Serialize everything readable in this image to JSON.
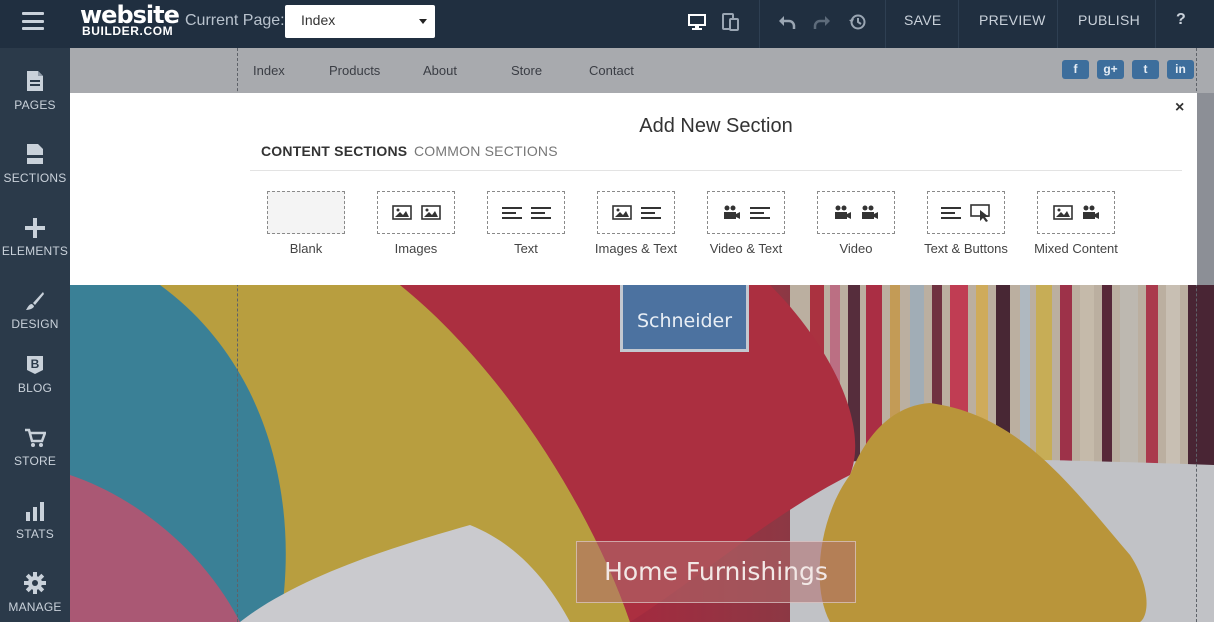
{
  "app": {
    "logo_main": "website",
    "logo_sub": "BUILDER.COM",
    "current_page_label": "Current Page:",
    "current_page_value": "Index"
  },
  "toolbar": {
    "icons": [
      "desktop-icon",
      "mobile-icon",
      "undo-icon",
      "redo-icon",
      "history-icon"
    ],
    "save_label": "SAVE",
    "preview_label": "PREVIEW",
    "publish_label": "PUBLISH",
    "help_label": "?"
  },
  "sidebar": {
    "items": [
      {
        "label": "PAGES",
        "icon": "page-icon"
      },
      {
        "label": "SECTIONS",
        "icon": "section-icon"
      },
      {
        "label": "ELEMENTS",
        "icon": "plus-icon"
      },
      {
        "label": "DESIGN",
        "icon": "brush-icon"
      },
      {
        "label": "BLOG",
        "icon": "blog-icon"
      },
      {
        "label": "STORE",
        "icon": "cart-icon"
      },
      {
        "label": "STATS",
        "icon": "bar-chart-icon"
      },
      {
        "label": "MANAGE",
        "icon": "gear-icon"
      }
    ]
  },
  "site": {
    "nav": [
      "Index",
      "Products",
      "About",
      "Store",
      "Contact"
    ],
    "social": [
      {
        "name": "facebook-icon",
        "glyph": "f"
      },
      {
        "name": "google-plus-icon",
        "glyph": "g+"
      },
      {
        "name": "twitter-icon",
        "glyph": "t"
      },
      {
        "name": "linkedin-icon",
        "glyph": "in"
      }
    ],
    "brand": "Schneider",
    "tagline": "Home Furnishings"
  },
  "panel": {
    "title": "Add New Section",
    "close": "×",
    "tabs": [
      "CONTENT SECTIONS",
      "COMMON SECTIONS"
    ],
    "options": [
      {
        "label": "Blank"
      },
      {
        "label": "Images"
      },
      {
        "label": "Text"
      },
      {
        "label": "Images & Text"
      },
      {
        "label": "Video & Text"
      },
      {
        "label": "Video"
      },
      {
        "label": "Text & Buttons"
      },
      {
        "label": "Mixed Content"
      }
    ]
  },
  "colors": {
    "topbar": "#202f40",
    "sidebar": "#2b3a4a",
    "brand_box": "#4c72a0",
    "social": "#3d6e9c"
  }
}
